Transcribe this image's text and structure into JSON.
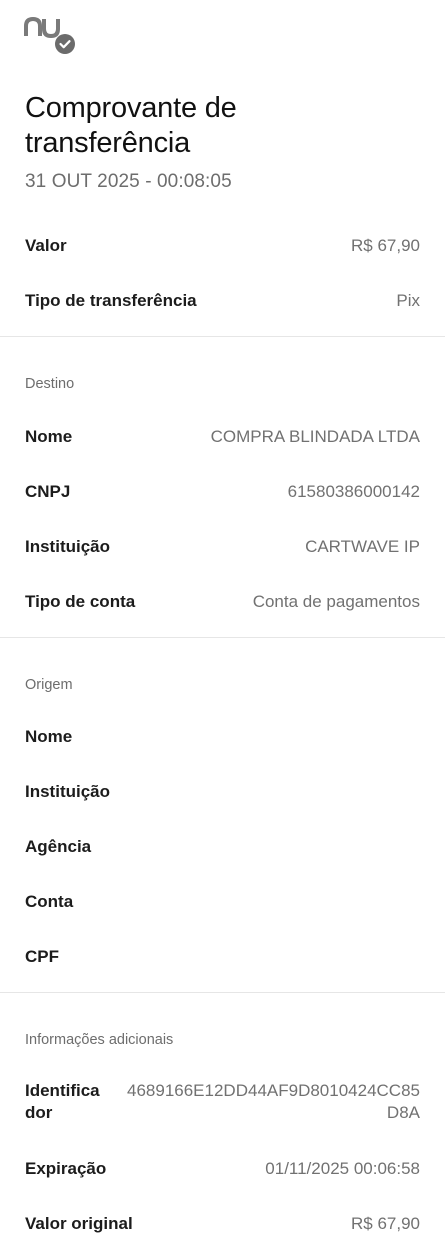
{
  "header": {
    "logo_icon": "nubank-verified-logo-icon",
    "brand_color": "#7a7a7a",
    "check_badge_color": "#6b6b6b"
  },
  "title": "Comprovante de transferência",
  "datetime": "31 OUT 2025 - 00:08:05",
  "summary": {
    "valor": {
      "label": "Valor",
      "value": "R$ 67,90"
    },
    "tipo": {
      "label": "Tipo de transferência",
      "value": "Pix"
    }
  },
  "destino": {
    "section_title": "Destino",
    "nome": {
      "label": "Nome",
      "value": "COMPRA BLINDADA LTDA"
    },
    "cnpj": {
      "label": "CNPJ",
      "value": "61580386000142"
    },
    "instituicao": {
      "label": "Instituição",
      "value": "CARTWAVE IP"
    },
    "tipo_conta": {
      "label": "Tipo de conta",
      "value": "Conta de pagamentos"
    }
  },
  "origem": {
    "section_title": "Origem",
    "nome": {
      "label": "Nome",
      "value": ""
    },
    "instituicao": {
      "label": "Instituição",
      "value": ""
    },
    "agencia": {
      "label": "Agência",
      "value": ""
    },
    "conta": {
      "label": "Conta",
      "value": ""
    },
    "cpf": {
      "label": "CPF",
      "value": ""
    }
  },
  "adicionais": {
    "section_title": "Informações adicionais",
    "identificador": {
      "label": "Identificador",
      "value": "4689166E12DD44AF9D8010424CC85D8A"
    },
    "expiracao": {
      "label": "Expiração",
      "value": "01/11/2025 00:06:58"
    },
    "valor_original": {
      "label": "Valor original",
      "value": "R$ 67,90"
    }
  }
}
